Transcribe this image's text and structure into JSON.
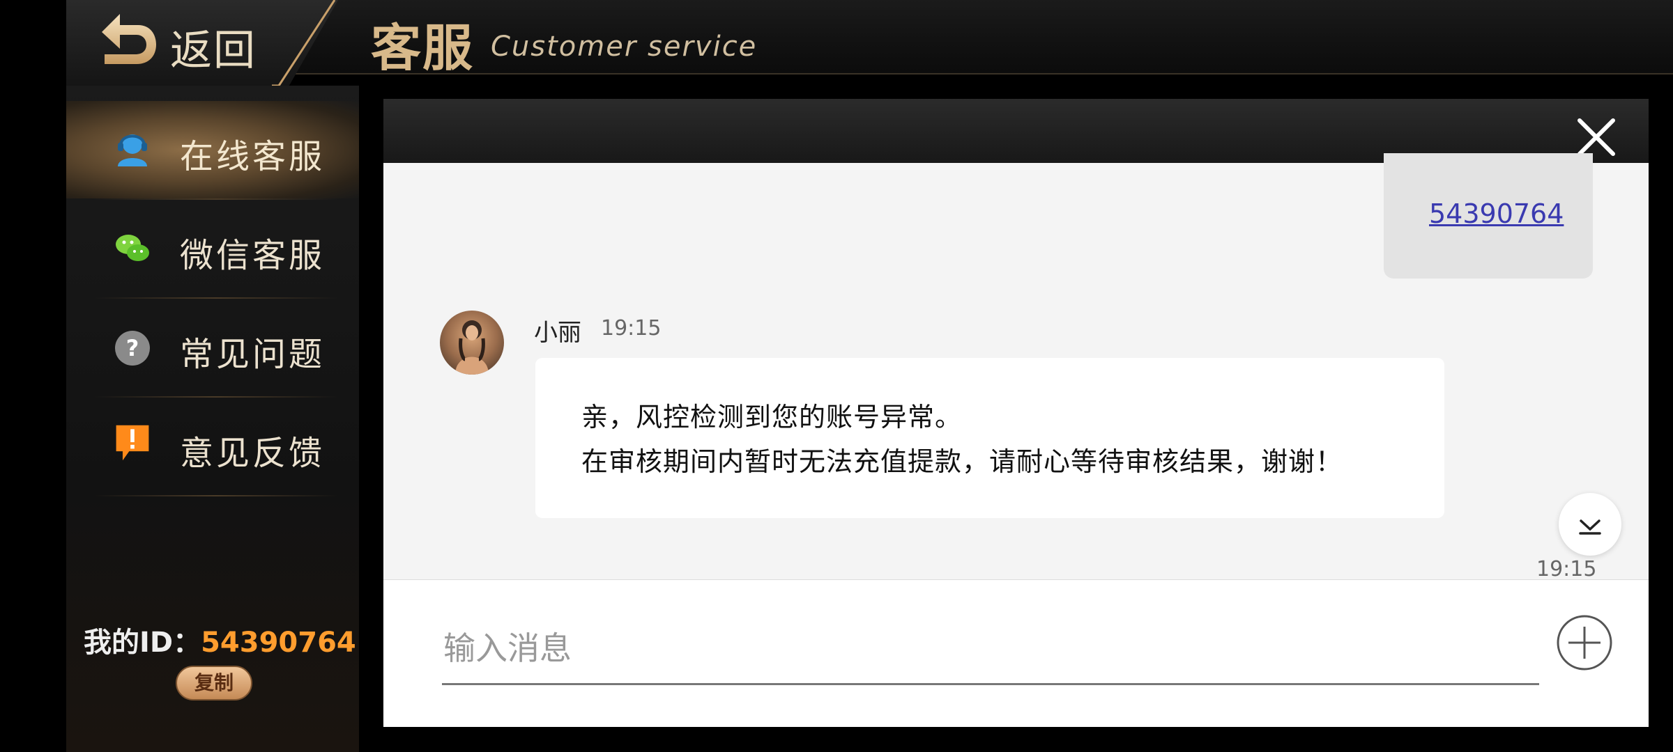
{
  "header": {
    "back_label": "返回",
    "title_cn": "客服",
    "title_en": "Customer service"
  },
  "sidebar": {
    "items": [
      {
        "label": "在线客服",
        "icon": "headset-user-icon",
        "active": true
      },
      {
        "label": "微信客服",
        "icon": "wechat-icon",
        "active": false
      },
      {
        "label": "常见问题",
        "icon": "question-icon",
        "active": false
      },
      {
        "label": "意见反馈",
        "icon": "feedback-exclamation-icon",
        "active": false
      }
    ],
    "my_id_label": "我的ID：",
    "my_id_value": "54390764",
    "copy_label": "复制"
  },
  "chat": {
    "outgoing_link": "54390764",
    "incoming": {
      "sender": "小丽",
      "time": "19:15",
      "lines": [
        "亲，风控检测到您的账号异常。",
        "在审核期间内暂时无法充值提款，请耐心等待审核结果，谢谢！"
      ]
    },
    "bottom_time": "19:15",
    "input_placeholder": "输入消息"
  },
  "colors": {
    "accent_gold": "#d8b98a",
    "id_orange": "#ff9d2e",
    "link_blue": "#3a3ab0"
  }
}
